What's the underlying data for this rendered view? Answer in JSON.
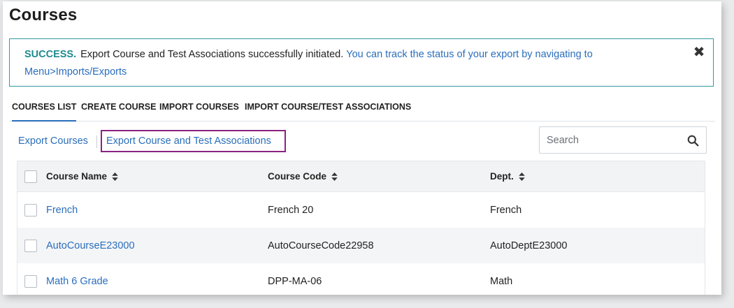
{
  "page": {
    "title": "Courses"
  },
  "alert": {
    "status": "SUCCESS.",
    "message": "Export Course and Test Associations successfully initiated.",
    "link_line1": "You can track the status of your export by navigating to",
    "link_line2": "Menu>Imports/Exports",
    "close_icon": "close-icon"
  },
  "tabs": [
    {
      "label": "COURSES LIST",
      "active": true
    },
    {
      "label": "CREATE COURSE",
      "active": false
    },
    {
      "label": "IMPORT COURSES",
      "active": false
    },
    {
      "label": "IMPORT COURSE/TEST ASSOCIATIONS",
      "active": false
    }
  ],
  "actions": {
    "export_courses": "Export Courses",
    "export_associations": "Export Course and Test Associations"
  },
  "search": {
    "placeholder": "Search",
    "value": "",
    "icon": "search-icon"
  },
  "table": {
    "columns": [
      "Course Name",
      "Course Code",
      "Dept."
    ],
    "rows": [
      {
        "name": "French",
        "code": "French 20",
        "dept": "French"
      },
      {
        "name": "AutoCourseE23000",
        "code": "AutoCourseCode22958",
        "dept": "AutoDeptE23000"
      },
      {
        "name": "Math 6 Grade",
        "code": "DPP-MA-06",
        "dept": "Math"
      }
    ]
  },
  "colors": {
    "accent": "#2a6ebb",
    "success": "#1e8a8f",
    "highlight": "#8b2381"
  }
}
